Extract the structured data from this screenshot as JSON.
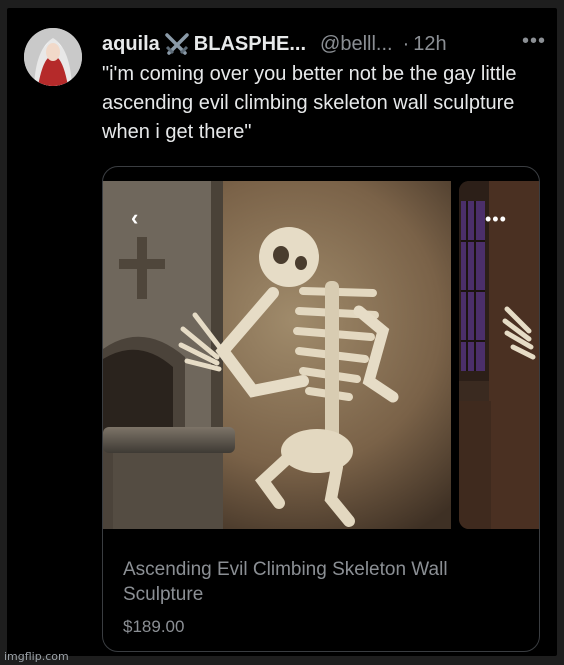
{
  "tweet": {
    "display_name": "aquila",
    "name_suffix": "BLASPHE...",
    "handle": "@belll...",
    "separator": "·",
    "time": "12h",
    "more_label": "•••",
    "text": "\"i'm coming over you better not be the gay little ascending evil climbing skeleton wall sculpture when i get there\""
  },
  "card": {
    "title": "Ascending Evil Climbing Skeleton Wall Sculpture",
    "price": "$189.00",
    "prev_label": "‹",
    "media_more_label": "•••"
  },
  "watermark": "imgflip.com",
  "icons": {
    "badge": "crossed-swords-icon",
    "more": "more-horizontal-icon",
    "prev": "chevron-left-icon"
  },
  "colors": {
    "background": "#000000",
    "text": "#e7e9ea",
    "muted": "#8b8f94",
    "border": "#3a3d41"
  }
}
